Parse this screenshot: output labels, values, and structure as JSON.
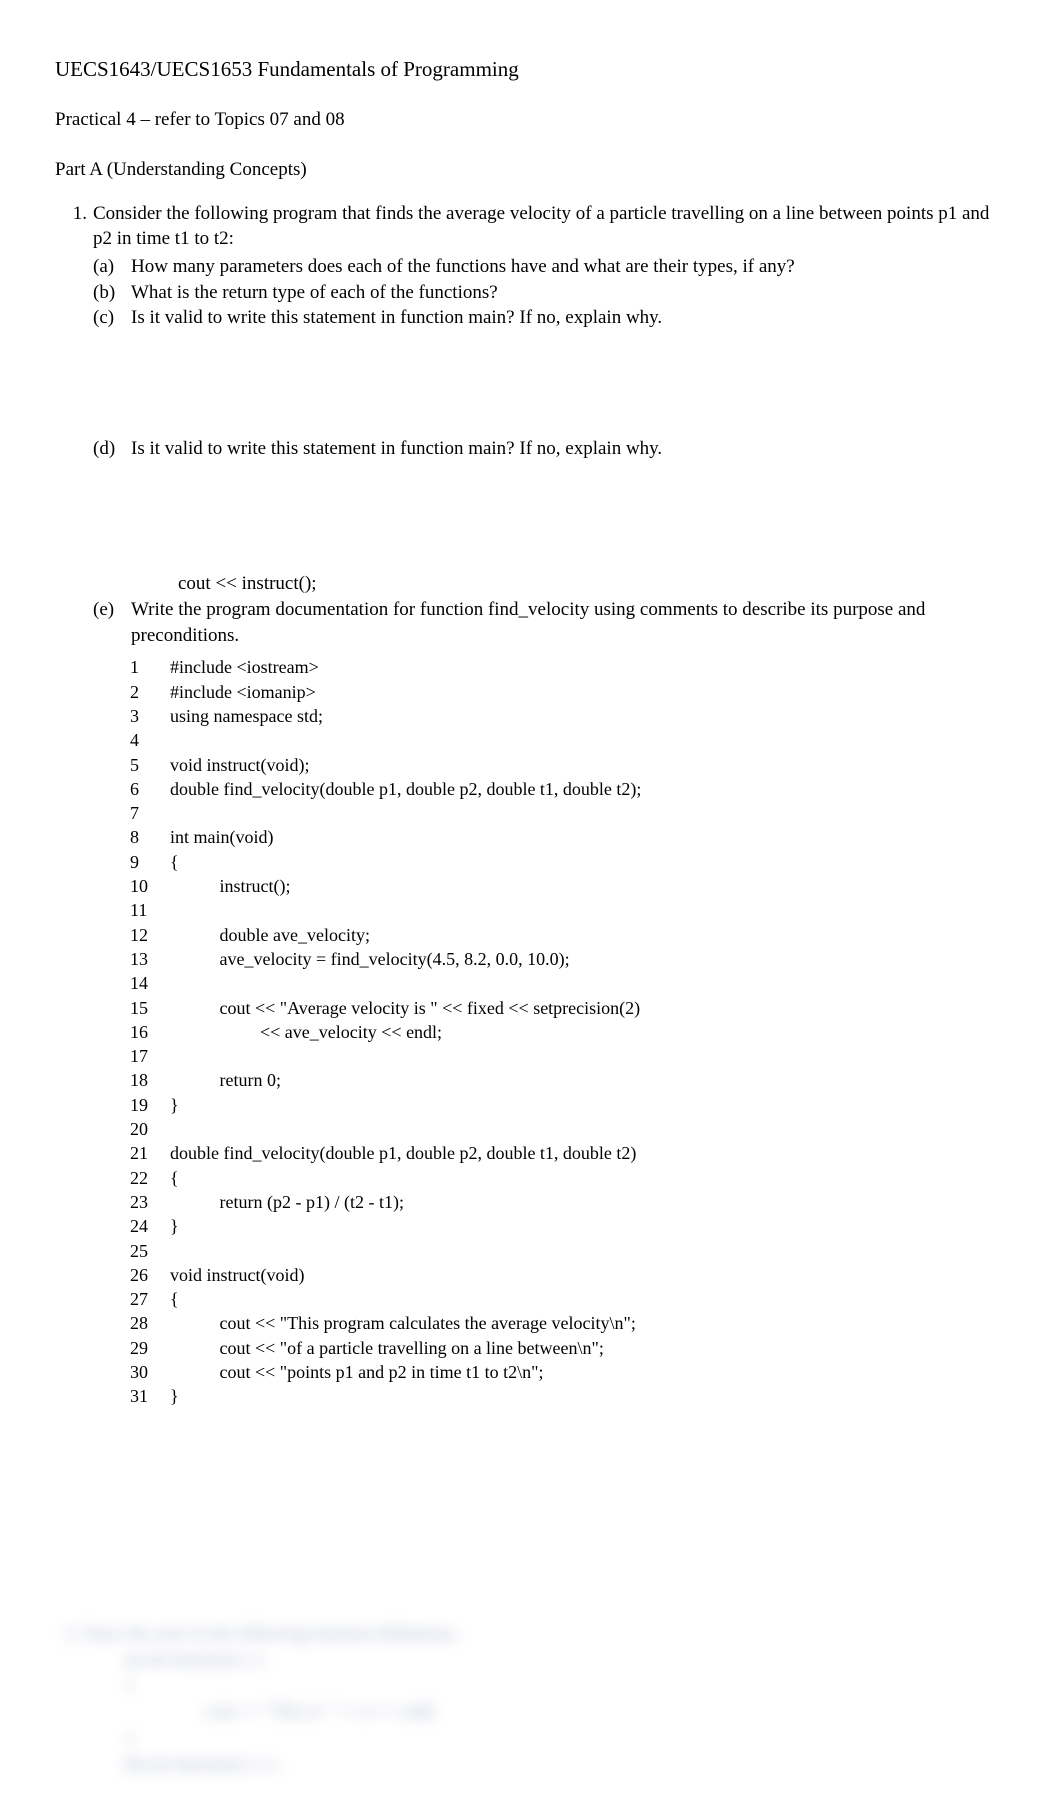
{
  "header": "UECS1643/UECS1653 Fundamentals of Programming",
  "subhead": "Practical 4   – refer to Topics 07 and 08",
  "part_a": "Part A (Understanding Concepts)",
  "q1": {
    "num": "1.",
    "text": "Consider the following program that finds the average velocity of a particle travelling on a line between points p1 and p2 in time t1 to t2:",
    "a": {
      "label": "(a)",
      "text": "How many parameters does each of the functions have and what are their types, if any?"
    },
    "b": {
      "label": "(b)",
      "text": "What is the return type of each of the functions?"
    },
    "c": {
      "label": "(c)",
      "text": "Is it valid to write this statement in function main? If no, explain why."
    },
    "d": {
      "label": "(d)",
      "text": "Is it valid to write this statement in function main? If no, explain why."
    },
    "d_code": "cout << instruct();",
    "e": {
      "label": "(e)",
      "text": "Write the program documentation for function find_velocity using comments to describe its purpose and preconditions."
    }
  },
  "code": [
    {
      "n": "1",
      "t": "#include <iostream>"
    },
    {
      "n": "2",
      "t": "#include <iomanip>"
    },
    {
      "n": "3",
      "t": "using namespace std;"
    },
    {
      "n": "4",
      "t": ""
    },
    {
      "n": "5",
      "t": "void instruct(void);"
    },
    {
      "n": "6",
      "t": "double find_velocity(double p1, double p2, double t1, double t2);"
    },
    {
      "n": "7",
      "t": ""
    },
    {
      "n": "8",
      "t": "int main(void)"
    },
    {
      "n": "9",
      "t": "{"
    },
    {
      "n": "10",
      "t": "           instruct();"
    },
    {
      "n": "11",
      "t": ""
    },
    {
      "n": "12",
      "t": "           double ave_velocity;"
    },
    {
      "n": "13",
      "t": "           ave_velocity = find_velocity(4.5, 8.2, 0.0, 10.0);"
    },
    {
      "n": "14",
      "t": ""
    },
    {
      "n": "15",
      "t": "           cout << \"Average velocity is \" << fixed << setprecision(2)"
    },
    {
      "n": "16",
      "t": "                    << ave_velocity << endl;"
    },
    {
      "n": "17",
      "t": ""
    },
    {
      "n": "18",
      "t": "           return 0;"
    },
    {
      "n": "19",
      "t": "}"
    },
    {
      "n": "20",
      "t": ""
    },
    {
      "n": "21",
      "t": "double find_velocity(double p1, double p2, double t1, double t2)"
    },
    {
      "n": "22",
      "t": "{"
    },
    {
      "n": "23",
      "t": "           return (p2 - p1) / (t2 - t1);"
    },
    {
      "n": "24",
      "t": "}"
    },
    {
      "n": "25",
      "t": ""
    },
    {
      "n": "26",
      "t": "void instruct(void)"
    },
    {
      "n": "27",
      "t": "{"
    },
    {
      "n": "28",
      "t": "           cout << \"This program calculates the average velocity\\n\";"
    },
    {
      "n": "29",
      "t": "           cout << \"of a particle travelling on a line between\\n\";"
    },
    {
      "n": "30",
      "t": "           cout << \"points p1 and p2 in time t1 to t2\\n\";"
    },
    {
      "n": "31",
      "t": "}"
    }
  ],
  "blurred": {
    "l1": "2.   Trace the error in the following function definitions.",
    "l2": "(a)   int function1 ( )",
    "l3": "{",
    "l4": "cout << \"This is \" << n << endl;",
    "l5": "}",
    "l6": "(b)   int function2 ( x )"
  }
}
